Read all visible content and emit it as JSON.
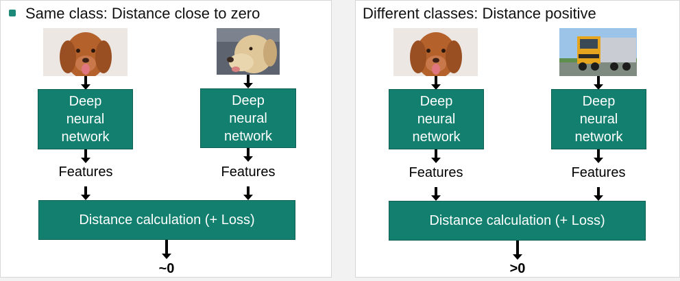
{
  "left_panel": {
    "title": "Same class: Distance close to zero",
    "net1": [
      "Deep",
      "neural",
      "network"
    ],
    "net2": [
      "Deep",
      "neural",
      "network"
    ],
    "features_label": "Features",
    "distance_label": "Distance calculation (+ Loss)",
    "result": "~0",
    "image1": "dog-photo-brown-retriever",
    "image2": "dog-photo-yellow-labrador"
  },
  "right_panel": {
    "title": "Different classes: Distance positive",
    "net1": [
      "Deep",
      "neural",
      "network"
    ],
    "net2": [
      "Deep",
      "neural",
      "network"
    ],
    "features_label": "Features",
    "distance_label": "Distance calculation (+ Loss)",
    "result": ">0",
    "image1": "dog-photo-brown-retriever",
    "image2": "truck-photo-yellow-lorry"
  },
  "colors": {
    "box_fill": "#127f6f",
    "bullet": "#1e8a7a"
  }
}
